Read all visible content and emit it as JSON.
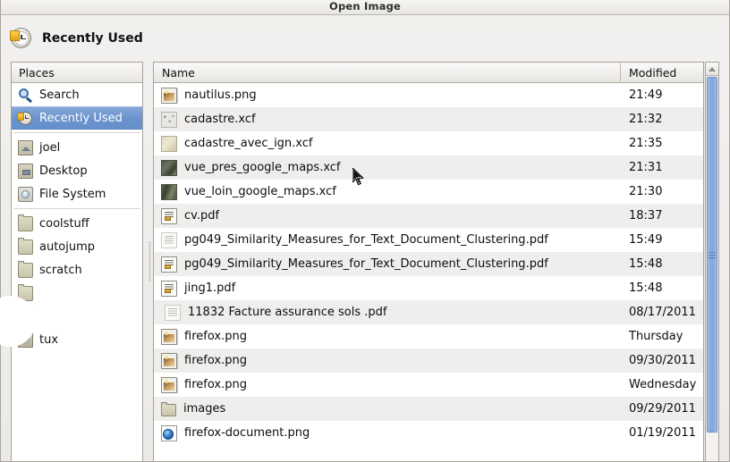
{
  "window": {
    "title": "Open Image"
  },
  "location": {
    "icon": "clock-icon",
    "name": "Recently Used"
  },
  "sidebar": {
    "header": "Places",
    "items": [
      {
        "label": "Search",
        "icon": "search-icon",
        "selected": false
      },
      {
        "label": "Recently Used",
        "icon": "clock-icon",
        "selected": true
      },
      {
        "label": "joel",
        "icon": "home-folder-icon",
        "selected": false
      },
      {
        "label": "Desktop",
        "icon": "desktop-folder-icon",
        "selected": false
      },
      {
        "label": "File System",
        "icon": "drive-icon",
        "selected": false
      },
      {
        "label": "coolstuff",
        "icon": "folder-icon",
        "selected": false
      },
      {
        "label": "autojump",
        "icon": "folder-icon",
        "selected": false
      },
      {
        "label": "scratch",
        "icon": "folder-icon",
        "selected": false
      },
      {
        "label": "tux",
        "icon": "folder-dark-icon",
        "selected": false
      }
    ]
  },
  "filelist": {
    "columns": {
      "name": "Name",
      "modified": "Modified"
    },
    "rows": [
      {
        "name": "nautilus.png",
        "modified": "21:49",
        "icon": "image-file-icon"
      },
      {
        "name": "cadastre.xcf",
        "modified": "21:32",
        "icon": "thumbnail-gray-icon"
      },
      {
        "name": "cadastre_avec_ign.xcf",
        "modified": "21:35",
        "icon": "thumbnail-tan-icon"
      },
      {
        "name": "vue_pres_google_maps.xcf",
        "modified": "21:31",
        "icon": "thumbnail-dark1-icon"
      },
      {
        "name": "vue_loin_google_maps.xcf",
        "modified": "21:30",
        "icon": "thumbnail-dark2-icon"
      },
      {
        "name": "cv.pdf",
        "modified": "18:37",
        "icon": "pdf-document-icon"
      },
      {
        "name": "pg049_Similarity_Measures_for_Text_Document_Clustering.pdf",
        "modified": "15:49",
        "icon": "pdf-document-faint-icon"
      },
      {
        "name": "pg049_Similarity_Measures_for_Text_Document_Clustering.pdf",
        "modified": "15:48",
        "icon": "pdf-document-icon"
      },
      {
        "name": "jing1.pdf",
        "modified": "15:48",
        "icon": "pdf-document-icon"
      },
      {
        "name": "11832 Facture assurance sols .pdf",
        "modified": "08/17/2011",
        "icon": "pdf-document-faint-icon"
      },
      {
        "name": "firefox.png",
        "modified": "Thursday",
        "icon": "image-file-icon"
      },
      {
        "name": "firefox.png",
        "modified": "09/30/2011",
        "icon": "image-file-icon"
      },
      {
        "name": "firefox.png",
        "modified": "Wednesday",
        "icon": "image-file-icon"
      },
      {
        "name": "images",
        "modified": "09/29/2011",
        "icon": "folder-icon"
      },
      {
        "name": "firefox-document.png",
        "modified": "01/19/2011",
        "icon": "firefox-document-icon"
      }
    ]
  },
  "scrollbar": {
    "up_button": "scroll-up-arrow"
  },
  "colors": {
    "selection": "#6b93cd",
    "scrollbar_thumb": "#8fb0de",
    "window_bg": "#eceae7",
    "row_alt": "#efeeec"
  }
}
